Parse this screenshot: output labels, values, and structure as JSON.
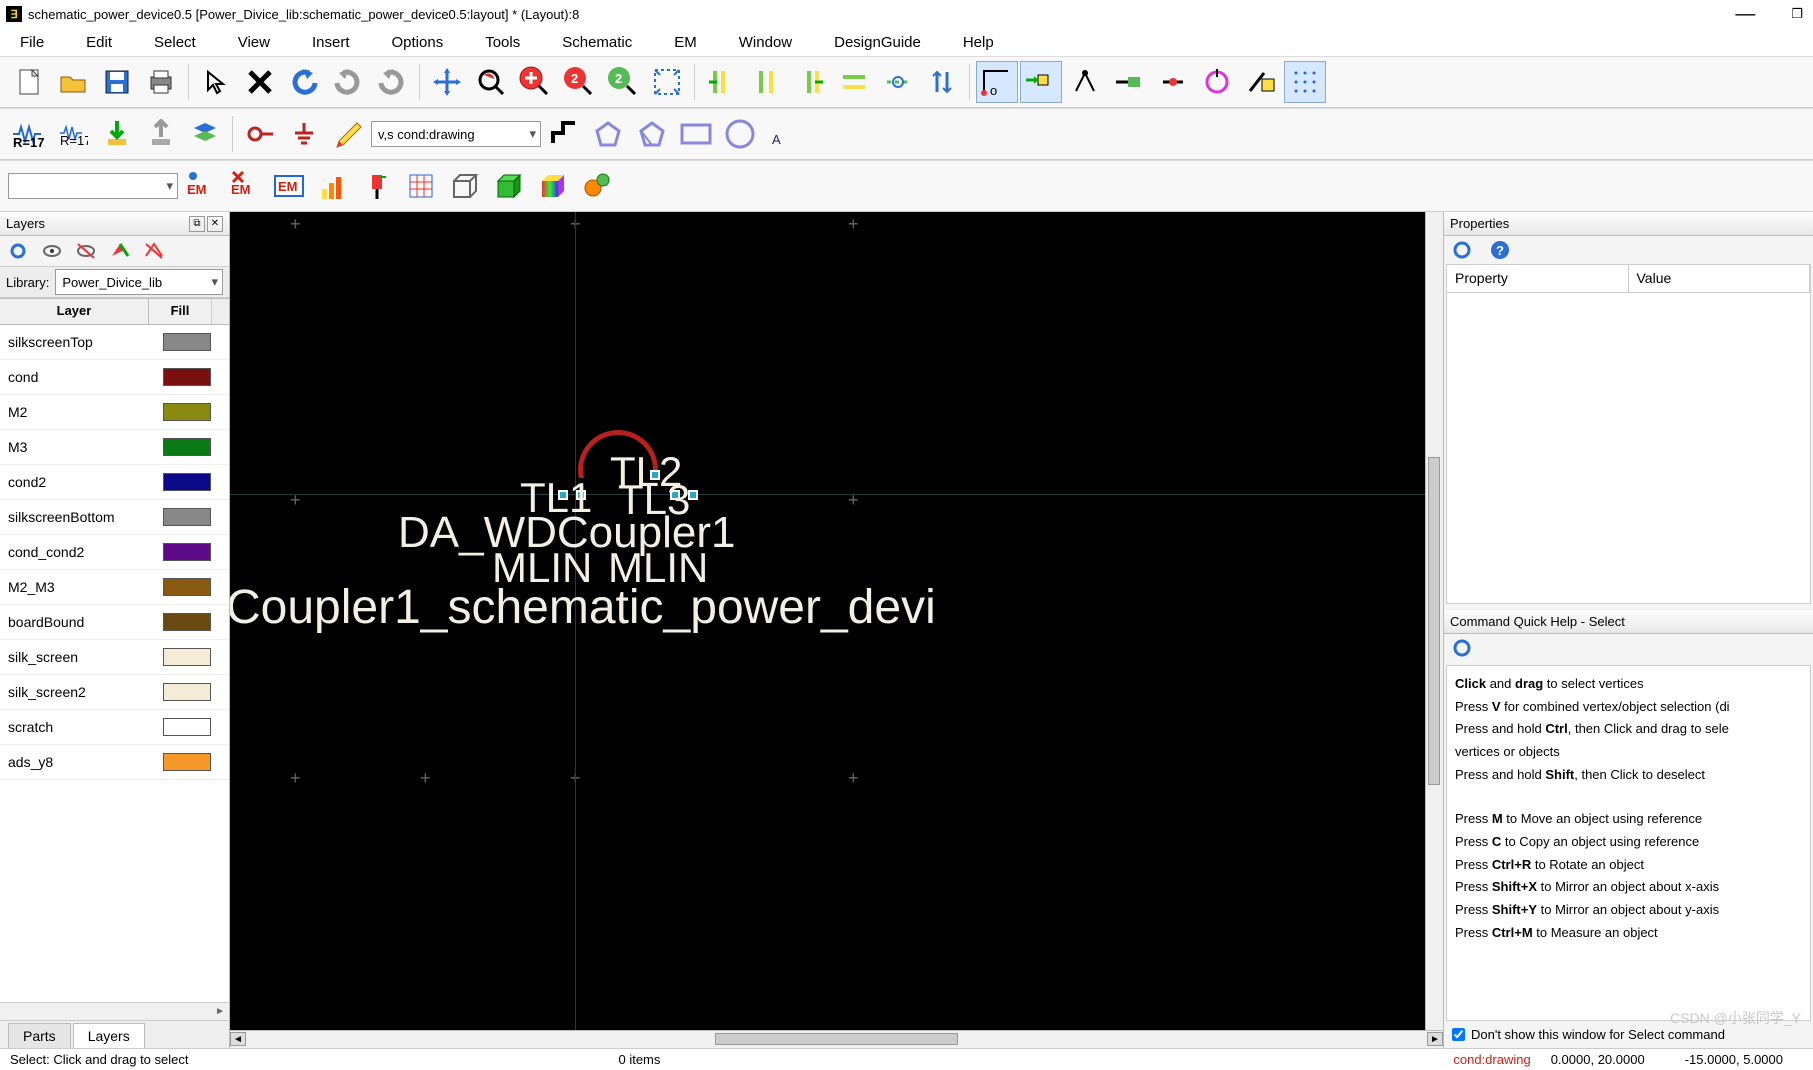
{
  "window": {
    "title": "schematic_power_device0.5 [Power_Divice_lib:schematic_power_device0.5:layout] * (Layout):8"
  },
  "menu": [
    "File",
    "Edit",
    "Select",
    "View",
    "Insert",
    "Options",
    "Tools",
    "Schematic",
    "EM",
    "Window",
    "DesignGuide",
    "Help"
  ],
  "layer_combo": "v,s cond:drawing",
  "layers_panel": {
    "title": "Layers",
    "library_label": "Library:",
    "library_value": "Power_Divice_lib",
    "headers": {
      "layer": "Layer",
      "fill": "Fill"
    },
    "rows": [
      {
        "name": "silkscreenTop",
        "color": "#888888"
      },
      {
        "name": "cond",
        "color": "#7a1010"
      },
      {
        "name": "M2",
        "color": "#8a8a10"
      },
      {
        "name": "M3",
        "color": "#0a7a16"
      },
      {
        "name": "cond2",
        "color": "#0b0b8a"
      },
      {
        "name": "silkscreenBottom",
        "color": "#888888"
      },
      {
        "name": "cond_cond2",
        "color": "#5f0a8a"
      },
      {
        "name": "M2_M3",
        "color": "#8a5a10"
      },
      {
        "name": "boardBound",
        "color": "#6a4a12"
      },
      {
        "name": "silk_screen",
        "color": "#f5ecd8"
      },
      {
        "name": "silk_screen2",
        "color": "#f5ecd8"
      },
      {
        "name": "scratch",
        "color": "#ffffff"
      },
      {
        "name": "ads_y8",
        "color": "#f59a2a"
      }
    ]
  },
  "tabs": {
    "parts": "Parts",
    "layers": "Layers"
  },
  "canvas_labels": {
    "tl2": "TL2",
    "tl1": "TL1",
    "tl3": "TL3",
    "da": "DA_WDCoupler1",
    "mlin": "MLIN",
    "mlin2": "MLIN",
    "coupler": "Coupler1_schematic_power_devi"
  },
  "properties": {
    "title": "Properties",
    "col1": "Property",
    "col2": "Value"
  },
  "help": {
    "title": "Command Quick Help - Select",
    "line1a": "Click",
    "line1b": " and ",
    "line1c": "drag",
    "line1d": " to select vertices",
    "line2a": "Press ",
    "line2b": "V",
    "line2c": " for combined vertex/object selection (di",
    "line3a": "Press and hold ",
    "line3b": "Ctrl",
    "line3c": ", then Click and drag to sele",
    "line4": "vertices or objects",
    "line5a": "Press and hold ",
    "line5b": "Shift",
    "line5c": ", then Click to deselect",
    "line6a": "Press ",
    "line6b": "M",
    "line6c": " to Move an object using reference",
    "line7a": "Press ",
    "line7b": "C",
    "line7c": " to Copy an object using reference",
    "line8a": "Press ",
    "line8b": "Ctrl+R",
    "line8c": " to Rotate an object",
    "line9a": "Press ",
    "line9b": "Shift+X",
    "line9c": " to Mirror an object about x-axis",
    "line10a": "Press ",
    "line10b": "Shift+Y",
    "line10c": " to Mirror an object about y-axis",
    "line11a": "Press ",
    "line11b": "Ctrl+M",
    "line11c": " to Measure an object",
    "checkbox": "Don't show this window for Select command"
  },
  "status": {
    "left": "Select: Click and drag to select",
    "items": "0 items",
    "layer": "cond:drawing",
    "c1": "0.0000, 20.0000",
    "c2": "-15.0000, 5.0000",
    "watermark": "CSDN @小张同学_Y"
  },
  "glyphs": {
    "max": "❐",
    "close": "✕",
    "pop": "⧉",
    "arrL": "◄",
    "arrR": "►"
  }
}
